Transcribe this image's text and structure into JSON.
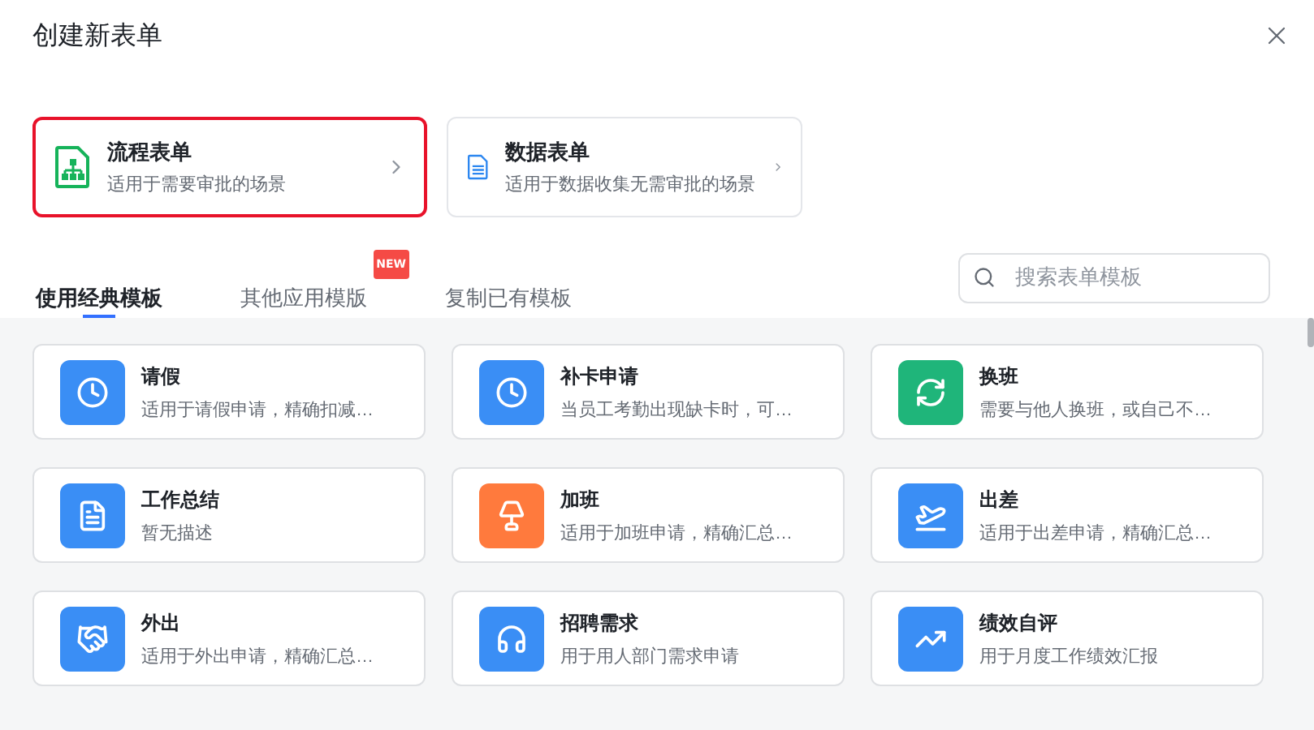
{
  "dialog": {
    "title": "创建新表单"
  },
  "form_types": [
    {
      "title": "流程表单",
      "description": "适用于需要审批的场景",
      "selected": true
    },
    {
      "title": "数据表单",
      "description": "适用于数据收集无需审批的场景",
      "selected": false
    }
  ],
  "tabs": [
    {
      "label": "使用经典模板",
      "selected": true
    },
    {
      "label": "其他应用模版",
      "selected": false,
      "badge": "NEW"
    },
    {
      "label": "复制已有模板",
      "selected": false
    }
  ],
  "search": {
    "placeholder": "搜索表单模板"
  },
  "templates": [
    {
      "title": "请假",
      "description": "适用于请假申请，精确扣减…",
      "color": "#3a8ef5"
    },
    {
      "title": "补卡申请",
      "description": "当员工考勤出现缺卡时，可…",
      "color": "#3a8ef5"
    },
    {
      "title": "换班",
      "description": "需要与他人换班，或自己不…",
      "color": "#1fb57a"
    },
    {
      "title": "工作总结",
      "description": "暂无描述",
      "color": "#3a8ef5"
    },
    {
      "title": "加班",
      "description": "适用于加班申请，精确汇总…",
      "color": "#ff7a3d"
    },
    {
      "title": "出差",
      "description": "适用于出差申请，精确汇总…",
      "color": "#3a8ef5"
    },
    {
      "title": "外出",
      "description": "适用于外出申请，精确汇总…",
      "color": "#3a8ef5"
    },
    {
      "title": "招聘需求",
      "description": "用于用人部门需求申请",
      "color": "#3a8ef5"
    },
    {
      "title": "绩效自评",
      "description": "用于月度工作绩效汇报",
      "color": "#3a8ef5"
    }
  ]
}
